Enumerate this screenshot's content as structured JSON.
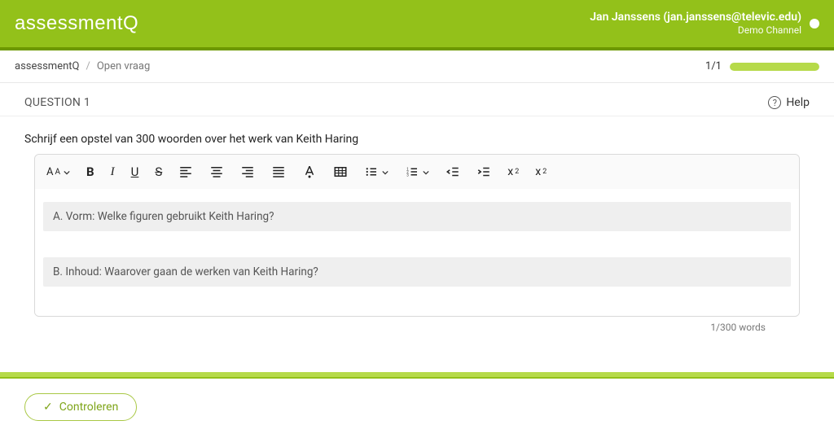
{
  "header": {
    "logo": "assessmentQ",
    "user_name": "Jan Janssens (jan.janssens@televic.edu)",
    "channel": "Demo Channel"
  },
  "breadcrumb": {
    "root": "assessmentQ",
    "item": "Open vraag",
    "progress_text": "1/1"
  },
  "question": {
    "label": "QUESTION 1",
    "help_label": "Help",
    "prompt": "Schrijf een opstel van 300 woorden over het werk van Keith Haring"
  },
  "editor": {
    "hint_a": "A. Vorm: Welke figuren gebruikt Keith Haring?",
    "hint_b": "B. Inhoud: Waarover gaan de werken van Keith Haring?",
    "wordcount": "1/300 words"
  },
  "footer": {
    "check_label": "Controleren"
  }
}
